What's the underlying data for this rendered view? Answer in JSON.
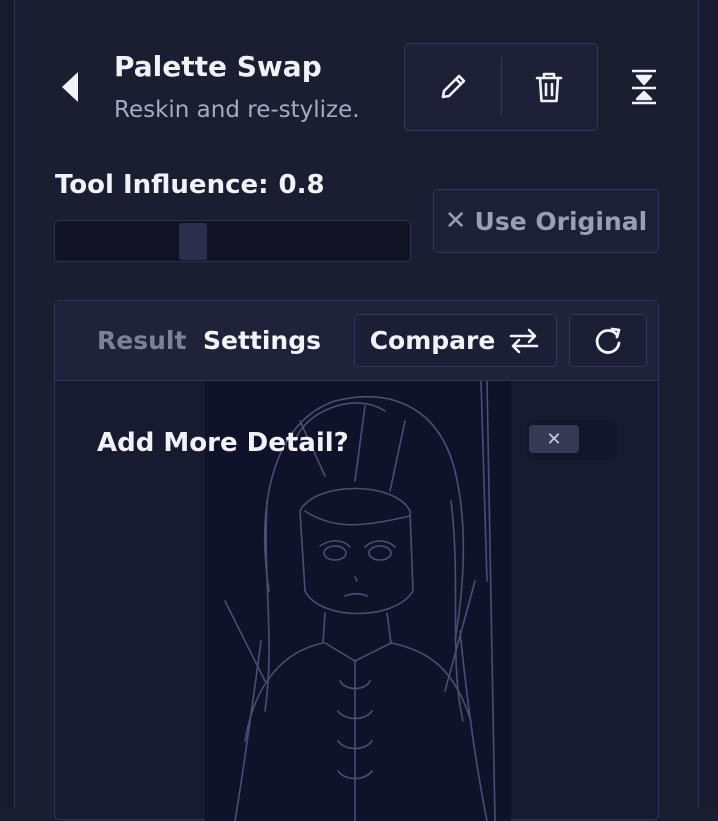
{
  "header": {
    "title": "Palette Swap",
    "subtitle": "Reskin and re-stylize."
  },
  "icons": {
    "back": "caret-left-icon",
    "edit": "pencil-icon",
    "delete": "trash-icon",
    "collapse": "collapse-vertical-icon",
    "use_original": "x-icon",
    "compare": "swap-arrows-icon",
    "refresh": "refresh-icon",
    "toggle_off": "x-icon"
  },
  "influence": {
    "label": "Tool Influence:",
    "value": "0.8",
    "slider_fraction": 0.38
  },
  "use_original": {
    "x_glyph": "✕",
    "label": "Use Original"
  },
  "panel": {
    "tabs": [
      "Result",
      "Settings"
    ],
    "active_tab": "Settings",
    "compare_label": "Compare",
    "detail_label": "Add More Detail?",
    "detail_enabled": false,
    "toggle_glyph": "✕"
  },
  "colors": {
    "background": "#1b1d31",
    "panel": "#181a2f",
    "border": "#34375a",
    "text": "#f1f2f8",
    "muted": "#a7aac4"
  }
}
